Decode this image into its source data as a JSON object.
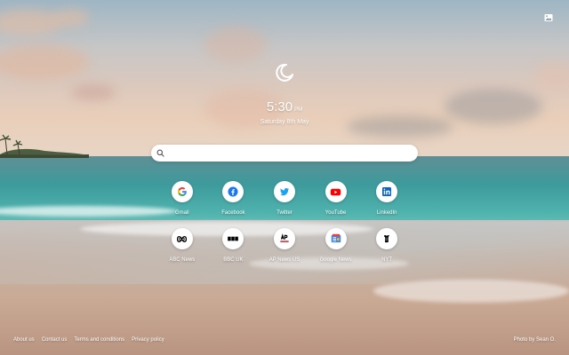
{
  "clock": {
    "time": "5:30",
    "ampm": "PM",
    "date": "Saturday 8th May"
  },
  "search": {
    "placeholder": "",
    "value": "",
    "icon": "search-icon"
  },
  "header": {
    "photo_button_icon": "image-icon"
  },
  "shortcuts": [
    {
      "label": "Gmail",
      "icon": "google-icon",
      "color": "#4285F4"
    },
    {
      "label": "Facebook",
      "icon": "facebook-icon",
      "color": "#1877F2"
    },
    {
      "label": "Twitter",
      "icon": "twitter-icon",
      "color": "#1DA1F2"
    },
    {
      "label": "YouTube",
      "icon": "youtube-icon",
      "color": "#FF0000"
    },
    {
      "label": "LinkedIn",
      "icon": "linkedin-icon",
      "color": "#0A66C2"
    },
    {
      "label": "ABC News",
      "icon": "abc-news-icon",
      "color": "#000000"
    },
    {
      "label": "BBC UK",
      "icon": "bbc-icon",
      "color": "#000000"
    },
    {
      "label": "AP News US",
      "icon": "ap-news-icon",
      "color": "#E41E26"
    },
    {
      "label": "Google News",
      "icon": "google-news-icon",
      "color": "#4285F4"
    },
    {
      "label": "NYT",
      "icon": "nyt-icon",
      "color": "#000000"
    }
  ],
  "footer": {
    "links": [
      "About us",
      "Contact us",
      "Terms and conditions",
      "Privacy policy"
    ],
    "credit": "Photo by Sean O."
  }
}
